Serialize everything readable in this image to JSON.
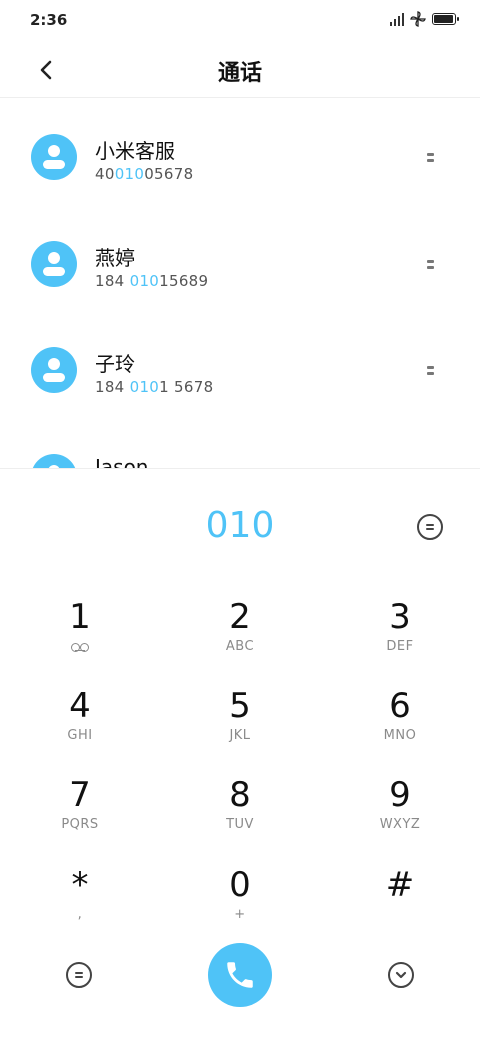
{
  "status_bar": {
    "time": "2:36",
    "signal_icon": "signal-bars-icon",
    "app_icon": "pinwheel-icon",
    "battery_icon": "battery-icon",
    "battery_level": 0.95
  },
  "header": {
    "title": "通话",
    "back_icon": "chevron-left-icon"
  },
  "contacts": [
    {
      "name": "小米客服",
      "number_pre": "40",
      "number_match": "010",
      "number_post": "05678"
    },
    {
      "name": "燕婷",
      "number_pre": "184 ",
      "number_match": "010",
      "number_post": "15689"
    },
    {
      "name": "子玲",
      "number_pre": "184 ",
      "number_match": "010",
      "number_post": "1 5678"
    },
    {
      "name": "Jason",
      "number_pre": "",
      "number_match": "",
      "number_post": ""
    }
  ],
  "dialer": {
    "input_value": "010"
  },
  "keypad": [
    {
      "digit": "1",
      "letters": ""
    },
    {
      "digit": "2",
      "letters": "ABC"
    },
    {
      "digit": "3",
      "letters": "DEF"
    },
    {
      "digit": "4",
      "letters": "GHI"
    },
    {
      "digit": "5",
      "letters": "JKL"
    },
    {
      "digit": "6",
      "letters": "MNO"
    },
    {
      "digit": "7",
      "letters": "PQRS"
    },
    {
      "digit": "8",
      "letters": "TUV"
    },
    {
      "digit": "9",
      "letters": "WXYZ"
    },
    {
      "digit": "*",
      "letters": ","
    },
    {
      "digit": "0",
      "letters": "+"
    },
    {
      "digit": "#",
      "letters": ""
    }
  ],
  "colors": {
    "accent": "#4fc3f7",
    "text_primary": "#111111",
    "text_secondary": "#555555"
  },
  "icons": {
    "menu": "menu-circle-icon",
    "call": "phone-icon",
    "collapse": "chevron-down-circle-icon",
    "voicemail": "voicemail-icon",
    "more": "more-options-icon",
    "avatar": "avatar-icon"
  }
}
